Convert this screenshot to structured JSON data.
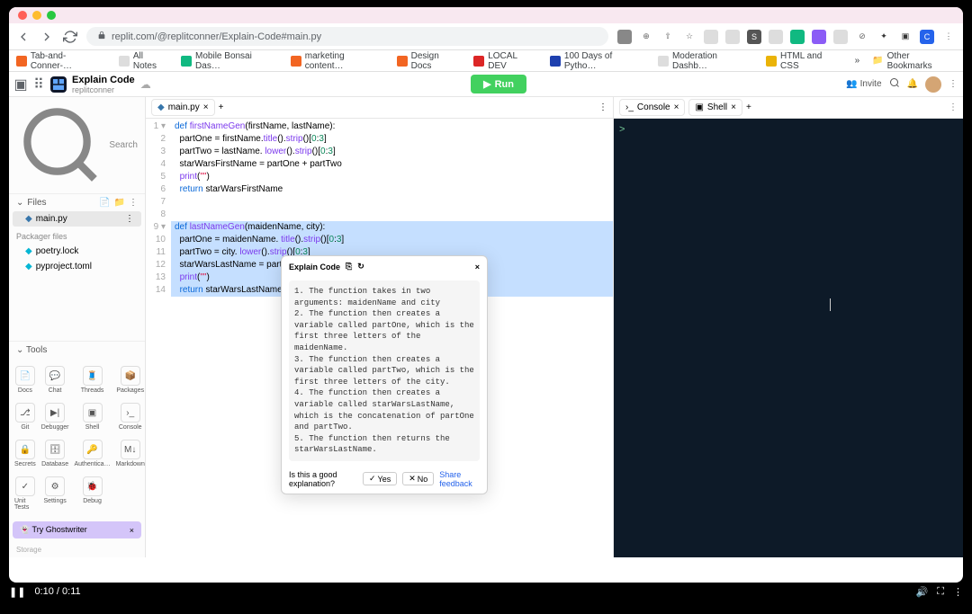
{
  "browser": {
    "url": "replit.com/@replitconner/Explain-Code#main.py",
    "bookmarks": [
      "Tab-and-Conner-…",
      "All Notes",
      "Mobile Bonsai Das…",
      "marketing content…",
      "Design Docs",
      "LOCAL DEV",
      "100 Days of Pytho…",
      "Moderation Dashb…",
      "HTML and CSS"
    ],
    "other_bookmarks": "Other Bookmarks",
    "overflow": "»"
  },
  "header": {
    "title": "Explain Code",
    "subtitle": "replitconner",
    "run": "Run",
    "invite": "Invite"
  },
  "sidebar": {
    "search": "Search",
    "files_label": "Files",
    "files": [
      {
        "name": "main.py",
        "color": "#3776ab",
        "active": true
      }
    ],
    "packager_label": "Packager files",
    "packager": [
      "poetry.lock",
      "pyproject.toml"
    ],
    "tools_label": "Tools",
    "tools": [
      "Docs",
      "Chat",
      "Threads",
      "Packages",
      "Git",
      "Debugger",
      "Shell",
      "Console",
      "Secrets",
      "Database",
      "Authentica…",
      "Markdown",
      "Unit Tests",
      "Settings",
      "Debug"
    ],
    "ghostwriter": "Try Ghostwriter",
    "storage": "Storage"
  },
  "editor": {
    "tab": "main.py",
    "lines": [
      {
        "n": 1,
        "html": "<span class='kw'>def</span> <span class='fn'>firstNameGen</span>(firstName, lastName):"
      },
      {
        "n": 2,
        "html": "  partOne = firstName.<span class='fn'>title</span>().<span class='fn'>strip</span>()[<span class='num'>0</span>:<span class='num'>3</span>]"
      },
      {
        "n": 3,
        "html": "  partTwo = lastName. <span class='fn'>lower</span>().<span class='fn'>strip</span>()[<span class='num'>0</span>:<span class='num'>3</span>]"
      },
      {
        "n": 4,
        "html": "  starWarsFirstName = partOne + partTwo"
      },
      {
        "n": 5,
        "html": "  <span class='fn'>print</span>(<span class='str'>\"\"</span>)"
      },
      {
        "n": 6,
        "html": "  <span class='kw'>return</span> starWarsFirstName"
      },
      {
        "n": 7,
        "html": ""
      },
      {
        "n": 8,
        "html": ""
      },
      {
        "n": 9,
        "hl": true,
        "html": "<span class='kw'>def</span> <span class='fn'>lastNameGen</span>(maidenName, city):"
      },
      {
        "n": 10,
        "hl": true,
        "html": "  partOne = maidenName. <span class='fn'>title</span>().<span class='fn'>strip</span>()[<span class='num'>0</span>:<span class='num'>3</span>]"
      },
      {
        "n": 11,
        "hl": true,
        "html": "  partTwo = city. <span class='fn'>lower</span>().<span class='fn'>strip</span>()[<span class='num'>0</span>:<span class='num'>3</span>]"
      },
      {
        "n": 12,
        "hl": true,
        "html": "  starWarsLastName = partOne + partTwo"
      },
      {
        "n": 13,
        "hl": true,
        "html": "  <span class='fn'>print</span>(<span class='str'>\"\"</span>)"
      },
      {
        "n": 14,
        "hl": true,
        "html": "  <span class='kw'>return</span> starWarsLastName"
      }
    ]
  },
  "explain": {
    "title": "Explain Code",
    "body": "1. The function takes in two arguments: maidenName and city\n2. The function then creates a variable called partOne, which is the first three letters of the maidenName.\n3. The function then creates a variable called partTwo, which is the first three letters of the city.\n4. The function then creates a variable called starWarsLastName, which is the concatenation of partOne and partTwo.\n5. The function then returns the starWarsLastName.",
    "question": "Is this a good explanation?",
    "yes": "Yes",
    "no": "No",
    "feedback": "Share feedback"
  },
  "console": {
    "tab1": "Console",
    "tab2": "Shell",
    "prompt": ">"
  },
  "video": {
    "time": "0:10 / 0:11"
  }
}
